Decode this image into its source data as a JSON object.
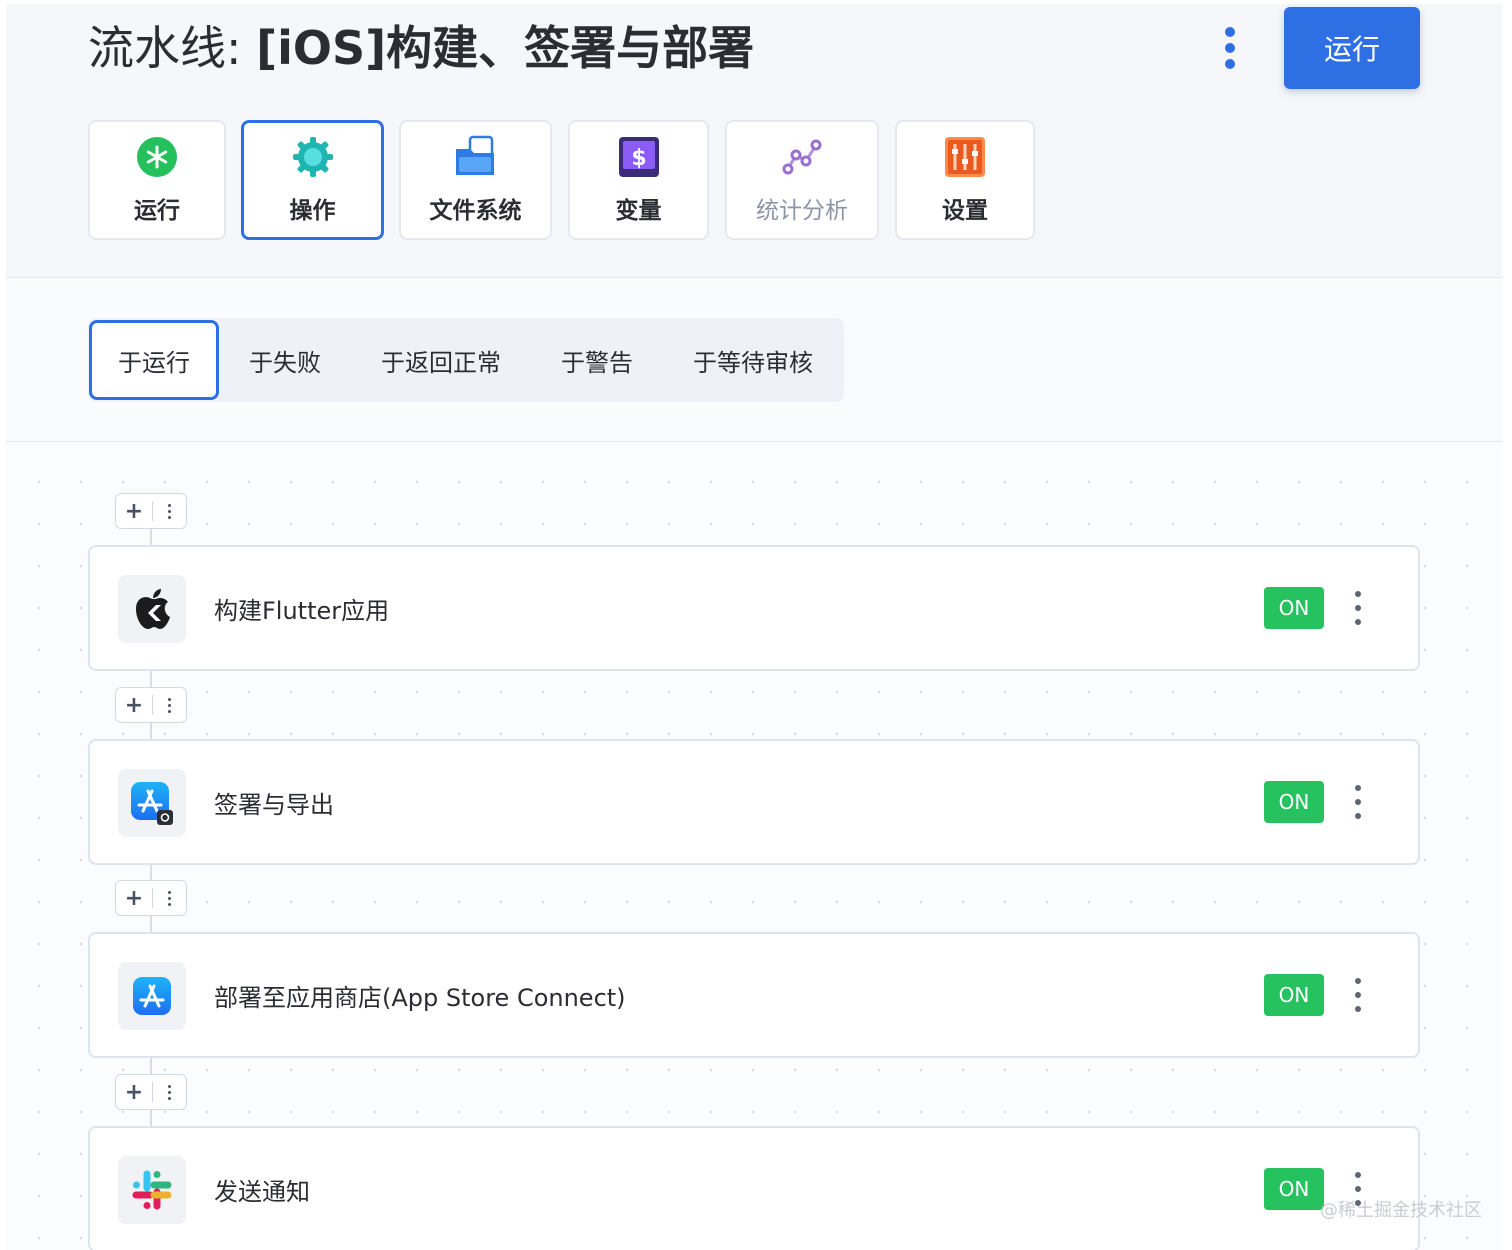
{
  "header": {
    "title_prefix": "流水线: ",
    "title_name": "[iOS]构建、签署与部署",
    "run_button": "运行"
  },
  "toolbar": [
    {
      "label": "运行",
      "icon": "green-asterisk-icon",
      "active": false,
      "muted": false
    },
    {
      "label": "操作",
      "icon": "teal-gear-icon",
      "active": true,
      "muted": false
    },
    {
      "label": "文件系统",
      "icon": "blue-folder-icon",
      "active": false,
      "muted": false
    },
    {
      "label": "变量",
      "icon": "purple-dollar-icon",
      "active": false,
      "muted": false
    },
    {
      "label": "统计分析",
      "icon": "purple-analytics-icon",
      "active": false,
      "muted": true
    },
    {
      "label": "设置",
      "icon": "orange-sliders-icon",
      "active": false,
      "muted": false
    }
  ],
  "trigger_tabs": [
    {
      "label": "于运行",
      "active": true
    },
    {
      "label": "于失败",
      "active": false
    },
    {
      "label": "于返回正常",
      "active": false
    },
    {
      "label": "于警告",
      "active": false
    },
    {
      "label": "于等待审核",
      "active": false
    }
  ],
  "steps": [
    {
      "title": "构建Flutter应用",
      "icon": "apple-flutter-icon",
      "status": "ON"
    },
    {
      "title": "签署与导出",
      "icon": "app-store-sign-icon",
      "status": "ON"
    },
    {
      "title": "部署至应用商店(App Store Connect)",
      "icon": "app-store-icon",
      "status": "ON"
    },
    {
      "title": "发送通知",
      "icon": "slack-icon",
      "status": "ON"
    }
  ],
  "step_controls": {
    "add_symbol": "+"
  },
  "watermark": "@稀土掘金技术社区",
  "colors": {
    "accent": "#2f6fe4",
    "on_green": "#25c25f"
  }
}
